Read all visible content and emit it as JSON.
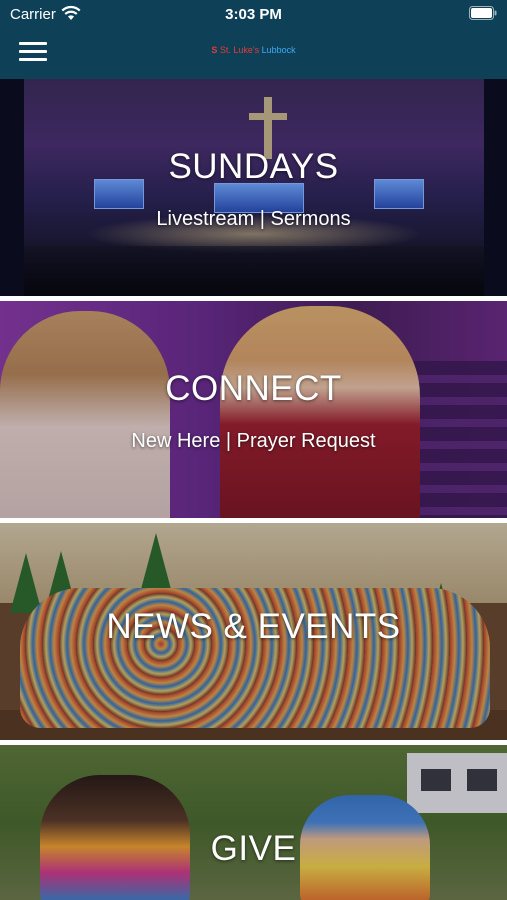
{
  "status_bar": {
    "carrier": "Carrier",
    "time": "3:03 PM",
    "icons": [
      "wifi-icon",
      "battery-icon"
    ]
  },
  "nav_bar": {
    "menu_icon": "hamburger-menu-icon",
    "logo_mark": "S",
    "logo_text_a": "St. Luke's ",
    "logo_text_b": "Lubbock",
    "background_color": "#0e4158"
  },
  "tiles": [
    {
      "title": "SUNDAYS",
      "subtitle": "Livestream | Sermons"
    },
    {
      "title": "CONNECT",
      "subtitle": "New Here | Prayer Request"
    },
    {
      "title": "NEWS & EVENTS",
      "subtitle": ""
    },
    {
      "title": "GIVE",
      "subtitle": ""
    }
  ]
}
